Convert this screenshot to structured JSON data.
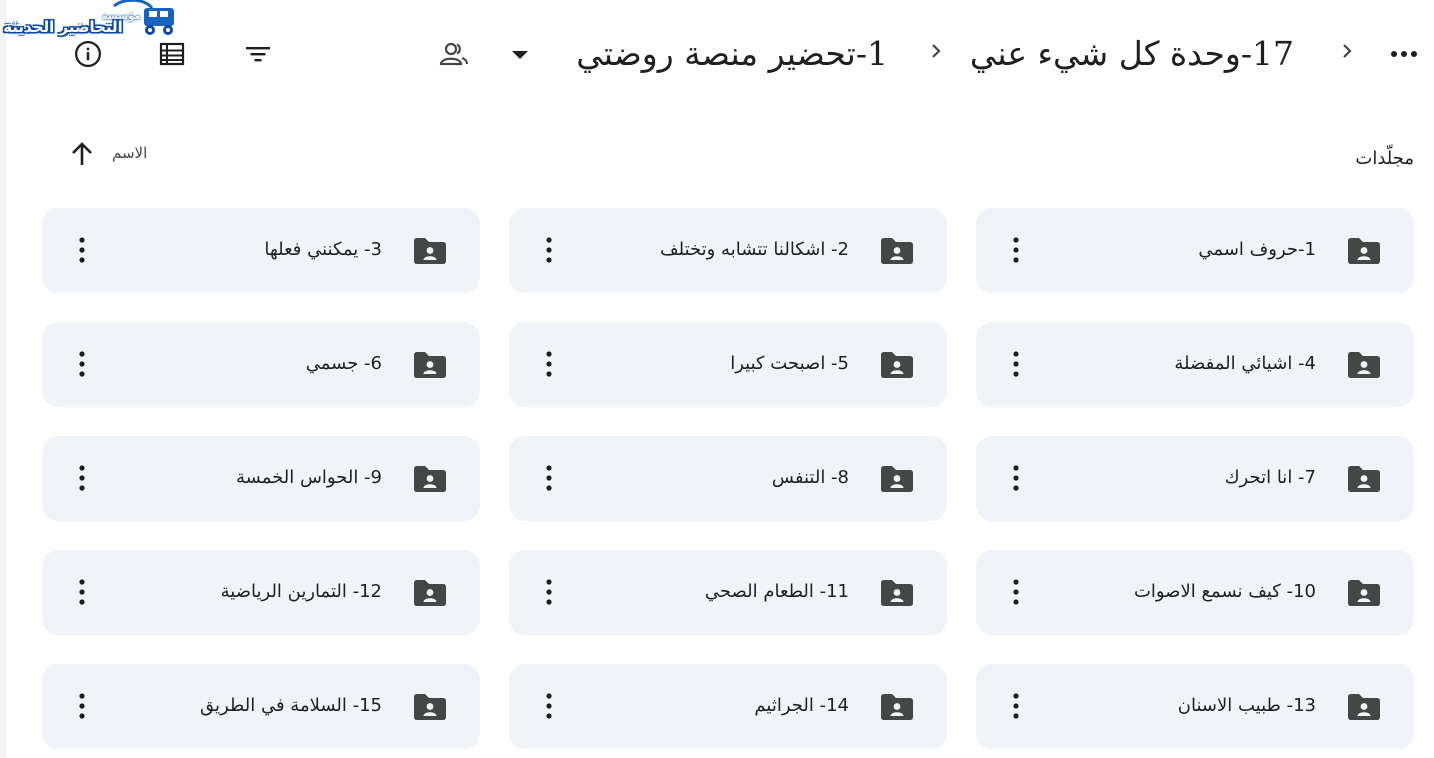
{
  "logo": {
    "small_text": "مؤسسة",
    "main_text": "التحاضير الحديثة"
  },
  "toolbar": {
    "icons": [
      "info-icon",
      "list-view-icon",
      "filter-icon",
      "shared-drive-icon",
      "more-vert-icon"
    ]
  },
  "breadcrumb": {
    "parent": "17-وحدة كل شيء عني",
    "current": "1-تحضير منصة روضتي"
  },
  "section": {
    "title": "مجلّدات",
    "sort_label": "الاسم"
  },
  "folders": [
    {
      "name": "1-حروف اسمي"
    },
    {
      "name": "2- اشكالنا تتشابه وتختلف"
    },
    {
      "name": "3- يمكنني فعلها"
    },
    {
      "name": "4- اشيائي المفضلة"
    },
    {
      "name": "5- اصبحت كبيرا"
    },
    {
      "name": "6- جسمي"
    },
    {
      "name": "7- انا اتحرك"
    },
    {
      "name": "8- التنفس"
    },
    {
      "name": "9- الحواس الخمسة"
    },
    {
      "name": "10- كيف نسمع الاصوات"
    },
    {
      "name": "11- الطعام الصحي"
    },
    {
      "name": "12- التمارين الرياضية"
    },
    {
      "name": "13- طبيب الاسنان"
    },
    {
      "name": "14- الجراثيم"
    },
    {
      "name": "15- السلامة في الطريق"
    }
  ],
  "colors": {
    "card_bg": "#f0f4f9",
    "icon": "#444746",
    "text": "#1f1f1f",
    "logo_blue": "#1565c0"
  }
}
